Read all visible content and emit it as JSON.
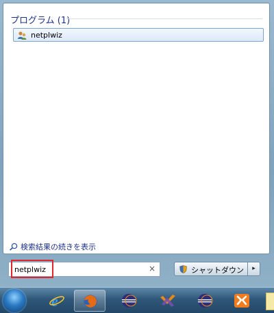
{
  "start_menu": {
    "group_header": "プログラム (1)",
    "results": [
      {
        "label": "netplwiz",
        "icon": "users-accounts-icon"
      }
    ],
    "see_more": "検索結果の続きを表示",
    "search": {
      "value": "netplwiz",
      "clear_glyph": "×"
    },
    "shutdown": {
      "label": "シャットダウン",
      "arrow_glyph": "▸"
    }
  },
  "taskbar": {
    "buttons": [
      {
        "name": "internet-explorer-icon"
      },
      {
        "name": "firefox-icon"
      },
      {
        "name": "eclipse-icon"
      },
      {
        "name": "visual-studio-icon"
      },
      {
        "name": "eclipse-icon"
      },
      {
        "name": "xampp-icon"
      }
    ]
  }
}
